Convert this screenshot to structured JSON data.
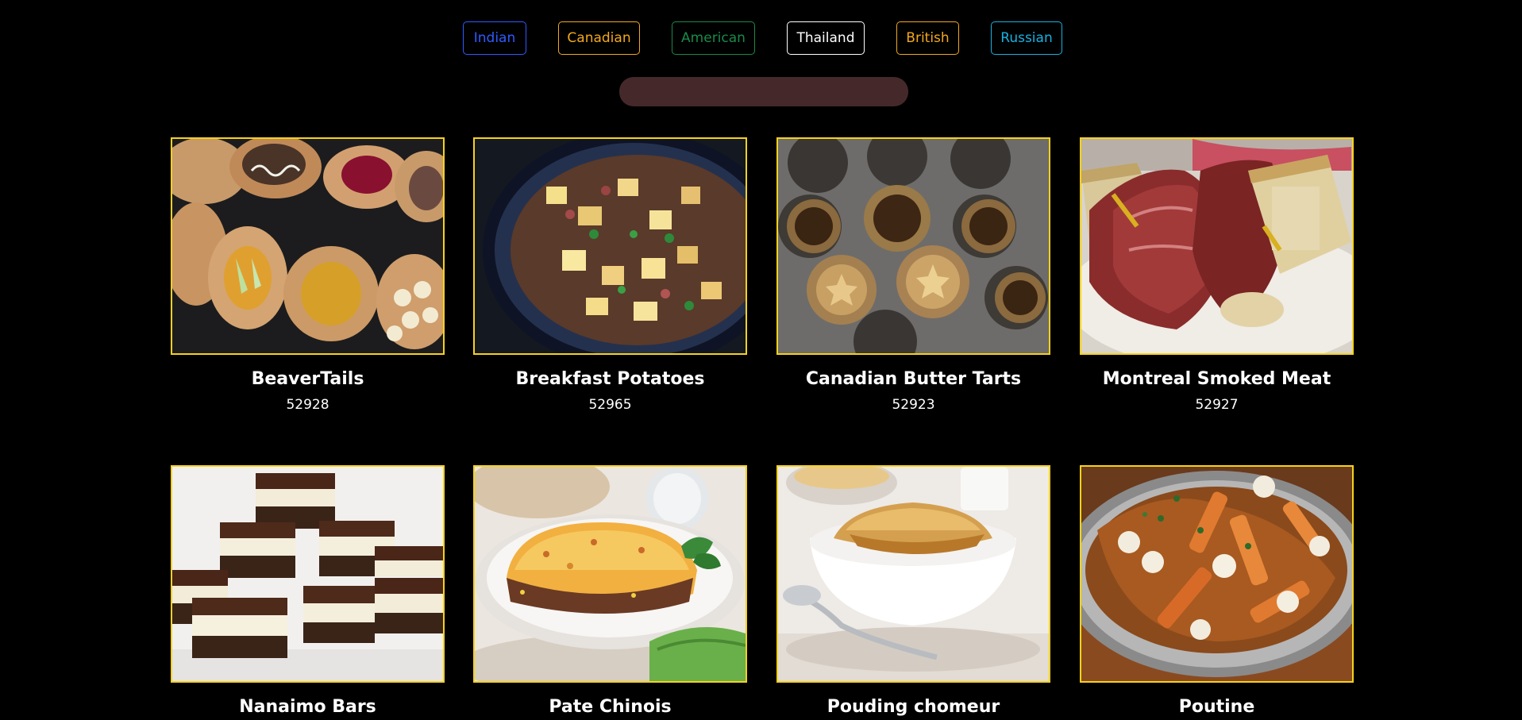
{
  "filters": [
    {
      "label": "Indian",
      "color": "#2f5bff"
    },
    {
      "label": "Canadian",
      "color": "#f2a81d"
    },
    {
      "label": "American",
      "color": "#1a8a48"
    },
    {
      "label": "Thailand",
      "color": "#ffffff"
    },
    {
      "label": "British",
      "color": "#f2a81d"
    },
    {
      "label": "Russian",
      "color": "#1ab0e0"
    }
  ],
  "search": {
    "placeholder": "",
    "value": ""
  },
  "meals": [
    {
      "name": "BeaverTails",
      "id": "52928"
    },
    {
      "name": "Breakfast Potatoes",
      "id": "52965"
    },
    {
      "name": "Canadian Butter Tarts",
      "id": "52923"
    },
    {
      "name": "Montreal Smoked Meat",
      "id": "52927"
    },
    {
      "name": "Nanaimo Bars",
      "id": ""
    },
    {
      "name": "Pate Chinois",
      "id": ""
    },
    {
      "name": "Pouding chomeur",
      "id": ""
    },
    {
      "name": "Poutine",
      "id": ""
    }
  ],
  "colors": {
    "card_border": "#f6d21d",
    "search_bg": "#45292a",
    "background": "#000000"
  }
}
